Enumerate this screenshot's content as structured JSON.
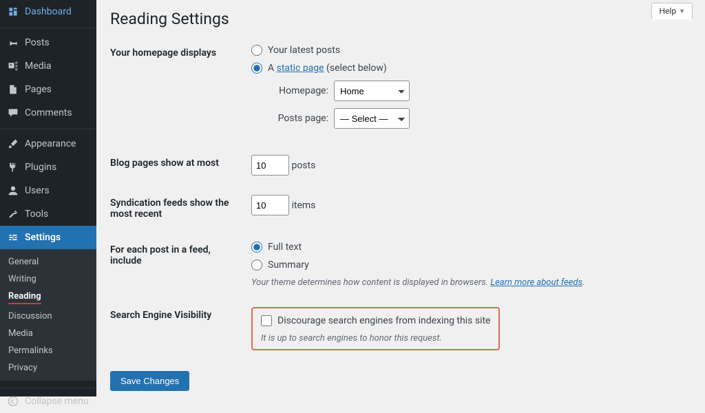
{
  "help_label": "Help",
  "page_title": "Reading Settings",
  "sidebar": {
    "items": [
      {
        "label": "Dashboard"
      },
      {
        "label": "Posts"
      },
      {
        "label": "Media"
      },
      {
        "label": "Pages"
      },
      {
        "label": "Comments"
      },
      {
        "label": "Appearance"
      },
      {
        "label": "Plugins"
      },
      {
        "label": "Users"
      },
      {
        "label": "Tools"
      },
      {
        "label": "Settings"
      }
    ],
    "submenu": [
      {
        "label": "General"
      },
      {
        "label": "Writing"
      },
      {
        "label": "Reading"
      },
      {
        "label": "Discussion"
      },
      {
        "label": "Media"
      },
      {
        "label": "Permalinks"
      },
      {
        "label": "Privacy"
      }
    ],
    "collapse_label": "Collapse menu"
  },
  "form": {
    "homepage_displays": {
      "label": "Your homepage displays",
      "opt_latest": "Your latest posts",
      "opt_static_prefix": "A ",
      "opt_static_link": "static page",
      "opt_static_suffix": " (select below)",
      "homepage_label": "Homepage:",
      "homepage_value": "Home",
      "postspage_label": "Posts page:",
      "postspage_value": "— Select —"
    },
    "blog_pages": {
      "label": "Blog pages show at most",
      "value": "10",
      "suffix": "posts"
    },
    "syndication": {
      "label": "Syndication feeds show the most recent",
      "value": "10",
      "suffix": "items"
    },
    "feed_content": {
      "label": "For each post in a feed, include",
      "opt_full": "Full text",
      "opt_summary": "Summary",
      "desc_prefix": "Your theme determines how content is displayed in browsers. ",
      "desc_link": "Learn more about feeds",
      "desc_suffix": "."
    },
    "visibility": {
      "label": "Search Engine Visibility",
      "checkbox_label": "Discourage search engines from indexing this site",
      "desc": "It is up to search engines to honor this request."
    },
    "submit": "Save Changes"
  }
}
